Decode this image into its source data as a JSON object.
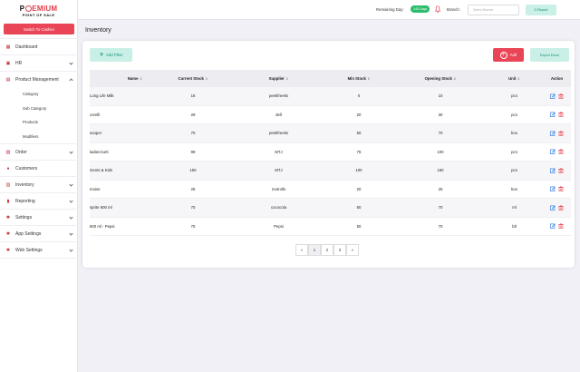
{
  "brand": {
    "logo_p": "P",
    "logo_rest": "EMIUM",
    "logo_sub": "POINT OF SALE"
  },
  "sidebar": {
    "switch_label": "Switch To Cashier",
    "items": [
      {
        "label": "Dashboard",
        "icon": "dashboard-icon"
      },
      {
        "label": "HR",
        "icon": "hr-icon"
      },
      {
        "label": "Product Management",
        "icon": "box-icon"
      },
      {
        "label": "Order",
        "icon": "cart-icon"
      },
      {
        "label": "Customers",
        "icon": "users-icon"
      },
      {
        "label": "Inventory",
        "icon": "inventory-icon"
      },
      {
        "label": "Reporting",
        "icon": "chart-icon"
      },
      {
        "label": "Settings",
        "icon": "gear-icon"
      },
      {
        "label": "App Settings",
        "icon": "app-settings-icon"
      },
      {
        "label": "Web Settings",
        "icon": "web-settings-icon"
      }
    ],
    "sub_items": [
      "Category",
      "Sub Category",
      "Products",
      "Modifiers"
    ]
  },
  "header": {
    "remaining_label": "Remaining Day:",
    "days_badge": "145 Days",
    "branch_label": "Branch:",
    "branch_placeholder": "Select Branch",
    "zreport_label": "Z-Report"
  },
  "page": {
    "title": "Inventory"
  },
  "toolbar": {
    "add_filter_label": "Add Filter",
    "add_label": "Add",
    "export_label": "Export Excel"
  },
  "table": {
    "columns": [
      "Name",
      "Current Stock",
      "Supplier",
      "Min Stock",
      "Opening Stock",
      "Unit",
      "Action"
    ],
    "rows": [
      {
        "name": "Long Life Milk",
        "current": "15",
        "supplier": "peekfreeks",
        "min": "0",
        "opening": "10",
        "unit": "pcs"
      },
      {
        "name": "corelli",
        "current": "29",
        "supplier": "dell",
        "min": "20",
        "opening": "30",
        "unit": "pcs"
      },
      {
        "name": "sooper",
        "current": "70",
        "supplier": "peekfreeks",
        "min": "50",
        "opening": "70",
        "unit": "box"
      },
      {
        "name": "ladies kurti",
        "current": "99",
        "supplier": "MTJ",
        "min": "75",
        "opening": "100",
        "unit": "pcs"
      },
      {
        "name": "Gents & Kids",
        "current": "150",
        "supplier": "MTJ",
        "min": "100",
        "opening": "150",
        "unit": "pcs"
      },
      {
        "name": "moise",
        "current": "25",
        "supplier": "motrolls",
        "min": "20",
        "opening": "25",
        "unit": "box"
      },
      {
        "name": "sprite 500 ml",
        "current": "70",
        "supplier": "cococola",
        "min": "60",
        "opening": "70",
        "unit": "ml"
      },
      {
        "name": "500 ml - Pepsi",
        "current": "70",
        "supplier": "Pepsi",
        "min": "50",
        "opening": "70",
        "unit": "btl"
      }
    ]
  },
  "pagination": {
    "prev": "«",
    "pages": [
      "1",
      "2",
      "3"
    ],
    "next": "»"
  },
  "colors": {
    "accent": "#e94556",
    "teal": "#c9efe6",
    "teal_text": "#1a8f79",
    "success": "#2bbd6b"
  }
}
